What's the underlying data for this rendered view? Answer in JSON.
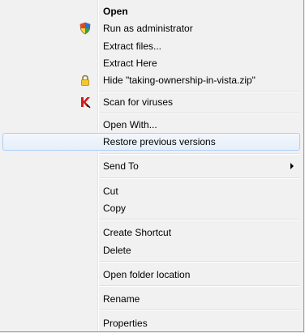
{
  "menu": {
    "open": "Open",
    "run_as_admin": "Run as administrator",
    "extract_files": "Extract files...",
    "extract_here": "Extract Here",
    "hide": "Hide \"taking-ownership-in-vista.zip\"",
    "scan": "Scan for viruses",
    "open_with": "Open With...",
    "restore": "Restore previous versions",
    "send_to": "Send To",
    "cut": "Cut",
    "copy": "Copy",
    "create_shortcut": "Create Shortcut",
    "delete": "Delete",
    "open_folder": "Open folder location",
    "rename": "Rename",
    "properties": "Properties"
  },
  "icons": {
    "run_as_admin": "uac-shield-icon",
    "hide": "padlock-icon",
    "scan": "kaspersky-k-icon",
    "send_to": "submenu-arrow-icon"
  }
}
